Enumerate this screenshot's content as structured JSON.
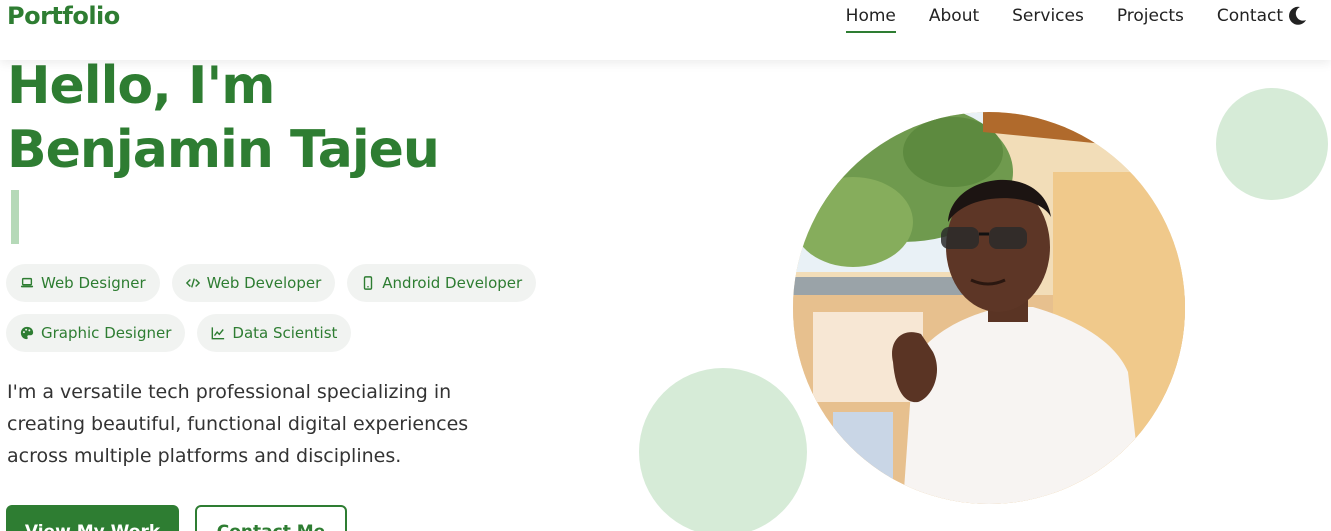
{
  "brand": "Portfolio",
  "nav": {
    "items": [
      {
        "label": "Home",
        "active": true
      },
      {
        "label": "About"
      },
      {
        "label": "Services"
      },
      {
        "label": "Projects"
      },
      {
        "label": "Contact"
      }
    ],
    "theme_toggle_icon": "moon-icon"
  },
  "hero": {
    "greeting": "Hello, I'm",
    "name": "Benjamin Tajeu",
    "roles": [
      {
        "label": "Web Designer",
        "icon": "laptop-icon"
      },
      {
        "label": "Web Developer",
        "icon": "code-icon"
      },
      {
        "label": "Android Developer",
        "icon": "mobile-icon"
      },
      {
        "label": "Graphic Designer",
        "icon": "palette-icon"
      },
      {
        "label": "Data Scientist",
        "icon": "chart-line-icon"
      }
    ],
    "intro": "I'm a versatile tech professional specializing in creating beautiful, functional digital experiences across multiple platforms and disciplines.",
    "primary_button": "View My Work",
    "secondary_button": "Contact Me"
  },
  "colors": {
    "accent": "#2e7d32",
    "accent_light": "#d6ebd7",
    "chip_bg": "#f1f3f1"
  }
}
